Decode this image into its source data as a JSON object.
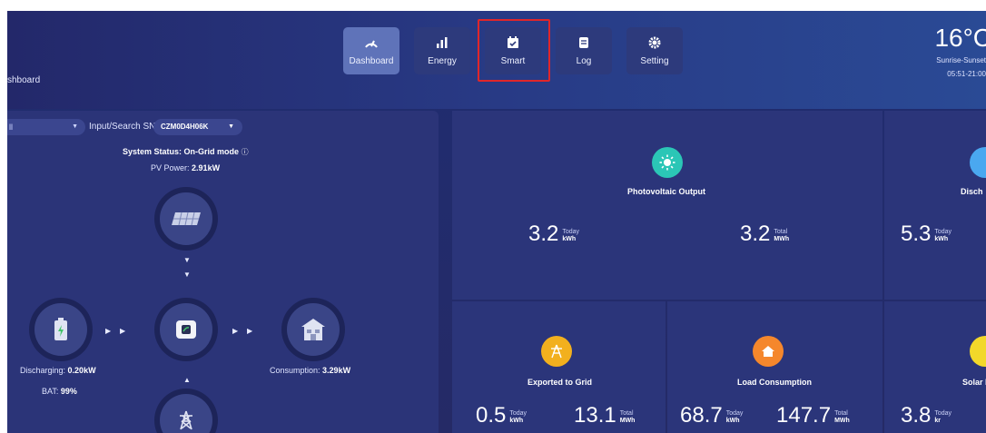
{
  "header": {
    "breadcrumb": "shboard",
    "nav": [
      {
        "id": "dashboard",
        "label": "Dashboard",
        "icon": "gauge-icon",
        "active": true
      },
      {
        "id": "energy",
        "label": "Energy",
        "icon": "bar-chart-icon",
        "active": false
      },
      {
        "id": "smart",
        "label": "Smart",
        "icon": "calendar-check-icon",
        "active": false
      },
      {
        "id": "log",
        "label": "Log",
        "icon": "log-list-icon",
        "active": false
      },
      {
        "id": "setting",
        "label": "Setting",
        "icon": "gear-icon",
        "active": false
      }
    ],
    "weather": {
      "temperature": "16°C",
      "sun_label": "Sunrise-Sunset",
      "sun_time": "05:51-21:00"
    }
  },
  "left": {
    "select_value": "ll",
    "sn_label": "Input/Search SN",
    "sn_value": "CZM0D4H06K",
    "system_status_label": "System Status:",
    "system_status_value": "On-Grid mode",
    "info_glyph": "ⓘ",
    "pv_power_label": "PV Power:",
    "pv_power_value": "2.91kW",
    "battery_label": "Discharging:",
    "battery_value": "0.20kW",
    "bat_label": "BAT:",
    "bat_value": "99%",
    "consumption_label": "Consumption:",
    "consumption_value": "3.29kW"
  },
  "cards": {
    "pv": {
      "title": "Photovoltaic Output",
      "today": "3.2",
      "today_lbl": "Today",
      "today_unit": "kWh",
      "total": "3.2",
      "total_lbl": "Total",
      "total_unit": "MWh",
      "color": "#2bc6b6"
    },
    "discharge": {
      "title": "Disch",
      "today": "5.3",
      "today_lbl": "Today",
      "today_unit": "kWh",
      "color": "#4aa8f0"
    },
    "export": {
      "title": "Exported to Grid",
      "today": "0.5",
      "today_lbl": "Today",
      "today_unit": "kWh",
      "total": "13.1",
      "total_lbl": "Total",
      "total_unit": "MWh",
      "color": "#f2b01e"
    },
    "load": {
      "title": "Load Consumption",
      "today": "68.7",
      "today_lbl": "Today",
      "today_unit": "kWh",
      "total": "147.7",
      "total_lbl": "Total",
      "total_unit": "MWh",
      "color": "#f5872c"
    },
    "solar": {
      "title": "Solar F",
      "today": "3.8",
      "today_lbl": "Today",
      "today_unit": "kr",
      "color": "#f2d82a"
    }
  },
  "colors": {
    "highlight": "#e0262a",
    "active_nav": "#5f73b9"
  }
}
